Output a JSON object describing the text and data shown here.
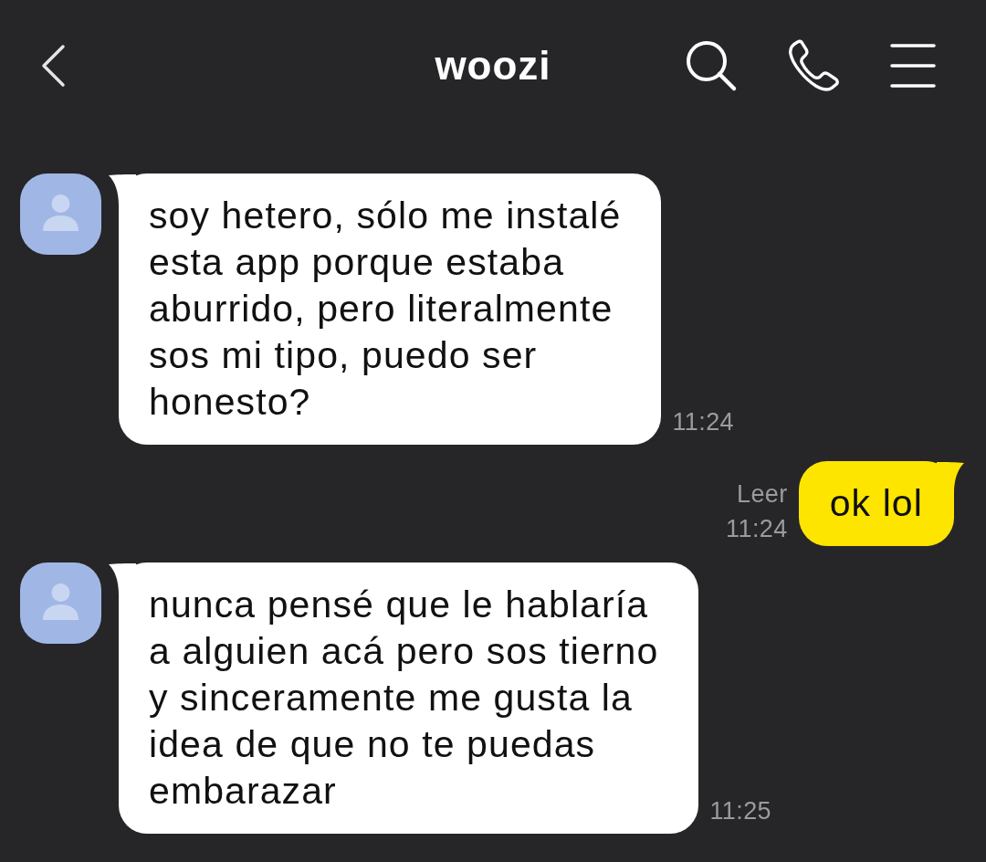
{
  "header": {
    "title": "woozi"
  },
  "messages": [
    {
      "kind": "received",
      "lines": [
        "soy hetero, sólo me instalé",
        "esta app porque estaba",
        "aburrido, pero literalmente",
        "sos mi tipo, puedo ser",
        "honesto?"
      ],
      "time": "11:24"
    },
    {
      "kind": "sent",
      "lines": [
        "ok lol"
      ],
      "status": "Leer",
      "time": "11:24"
    },
    {
      "kind": "received",
      "lines": [
        "nunca pensé que le hablaría",
        "a alguien acá pero sos tierno",
        "y sinceramente me gusta la",
        "idea de que no te puedas",
        "embarazar"
      ],
      "time": "11:25"
    }
  ]
}
